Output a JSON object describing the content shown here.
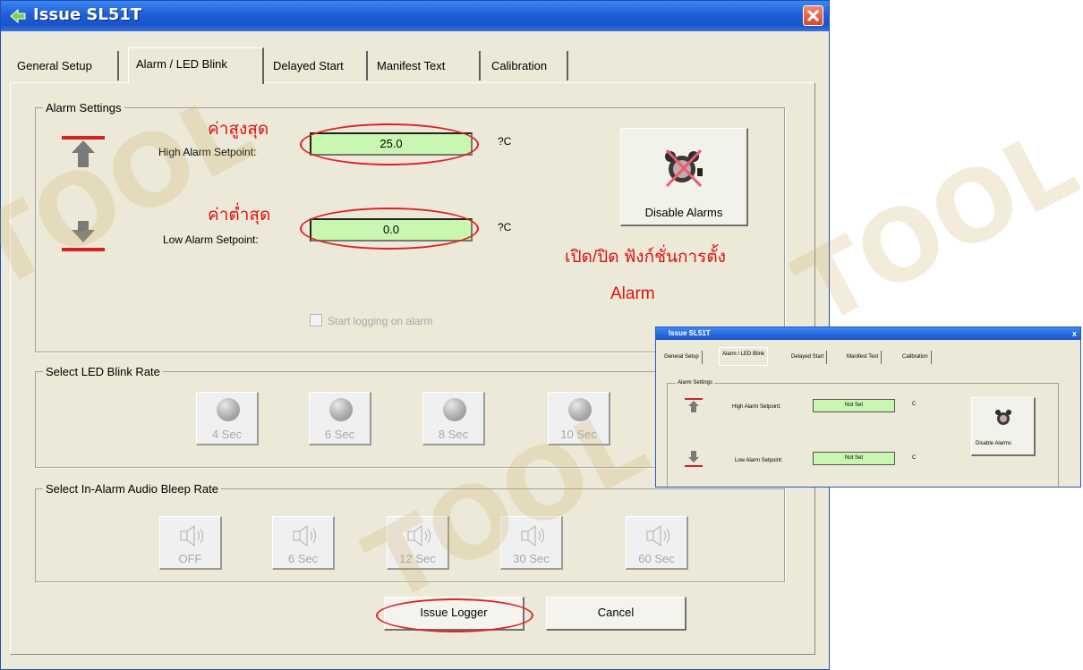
{
  "window": {
    "title": "Issue  SL51T"
  },
  "tabs": [
    {
      "label": "General Setup"
    },
    {
      "label": "Alarm / LED Blink"
    },
    {
      "label": "Delayed Start"
    },
    {
      "label": "Manifest Text"
    },
    {
      "label": "Calibration"
    }
  ],
  "alarm": {
    "group_label": "Alarm Settings",
    "high_label": "High Alarm Setpoint:",
    "high_value": "25.0",
    "high_unit": "?C",
    "low_label": "Low Alarm Setpoint:",
    "low_value": "0.0",
    "low_unit": "?C",
    "disable_button": "Disable Alarms",
    "start_logging": "Start logging on alarm"
  },
  "annotations": {
    "high_th": "ค่าสูงสุด",
    "low_th": "ค่าต่ำสุด",
    "toggle_line1": "เปิด/ปิด  ฟังก์ชั่นการตั้ง",
    "toggle_line2": "Alarm"
  },
  "led": {
    "group_label": "Select LED Blink Rate",
    "options": [
      "4 Sec",
      "6 Sec",
      "8 Sec",
      "10 Sec"
    ]
  },
  "audio": {
    "group_label": "Select In-Alarm Audio Bleep Rate",
    "options": [
      "OFF",
      "6 Sec",
      "12 Sec",
      "30 Sec",
      "60 Sec"
    ]
  },
  "buttons": {
    "issue": "Issue Logger",
    "cancel": "Cancel"
  },
  "inset": {
    "title": "Issue  SL51T",
    "tabs": [
      "General Setup",
      "Alarm / LED Blink",
      "Delayed Start",
      "Manifest Text",
      "Calibration"
    ],
    "group_label": "Alarm Settings",
    "high_label": "High Alarm Setpoint:",
    "low_label": "Low Alarm Setpoint:",
    "high_value": "Not Set",
    "low_value": "Not Set",
    "unit": "C",
    "disable_button": "Disable Alarms",
    "close": "x"
  },
  "colors": {
    "title_bar": "#1f5fd6",
    "field_green": "#c9f7b1",
    "annotation_red": "#d11"
  }
}
